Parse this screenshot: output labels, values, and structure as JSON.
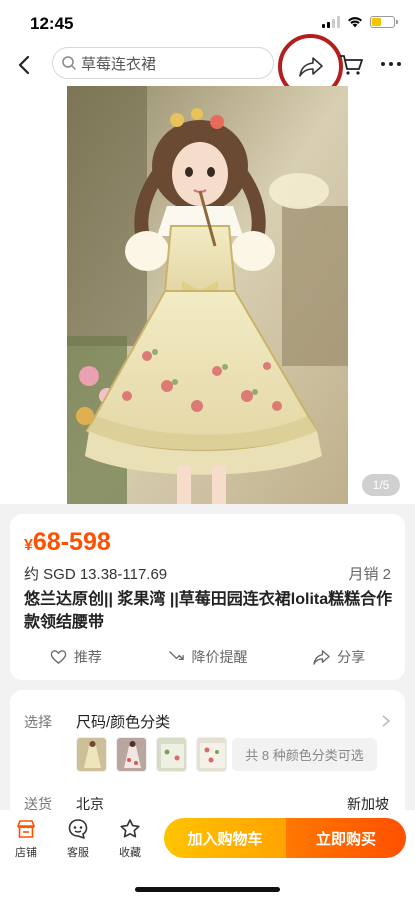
{
  "status_bar": {
    "time": "12:45",
    "battery_color": "#f5c400"
  },
  "nav": {
    "search_text": "草莓连衣裙",
    "icons": [
      "back-icon",
      "search-icon",
      "share-icon",
      "cart-icon",
      "more-icon"
    ],
    "highlight_color": "#b41e1e"
  },
  "gallery": {
    "counter": "1/5"
  },
  "product": {
    "price_symbol": "¥",
    "price_range": "68-598",
    "price_color": "#ff5000",
    "sgd_price": "约 SGD 13.38-117.69",
    "monthly_sales": "月销 2",
    "title": "悠兰达原创|| 浆果湾 ||草莓田园连衣裙lolita糕糕合作款领结腰带",
    "actions": [
      {
        "label": "推荐",
        "icon": "heart-icon"
      },
      {
        "label": "降价提醒",
        "icon": "price-drop-icon"
      },
      {
        "label": "分享",
        "icon": "share-icon"
      }
    ]
  },
  "options": {
    "select_label": "选择",
    "select_value": "尺码/颜色分类",
    "variants_text": "共 8 种颜色分类可选",
    "shipping_label": "送货",
    "ship_from": "北京",
    "ship_to": "新加坡"
  },
  "bottom_bar": {
    "tabs": [
      {
        "label": "店铺",
        "icon": "store-icon"
      },
      {
        "label": "客服",
        "icon": "customer-service-icon"
      },
      {
        "label": "收藏",
        "icon": "star-icon"
      }
    ],
    "add_to_cart": "加入购物车",
    "buy_now": "立即购买",
    "cart_color": "#ffb300",
    "buy_color": "#ff5a00"
  }
}
